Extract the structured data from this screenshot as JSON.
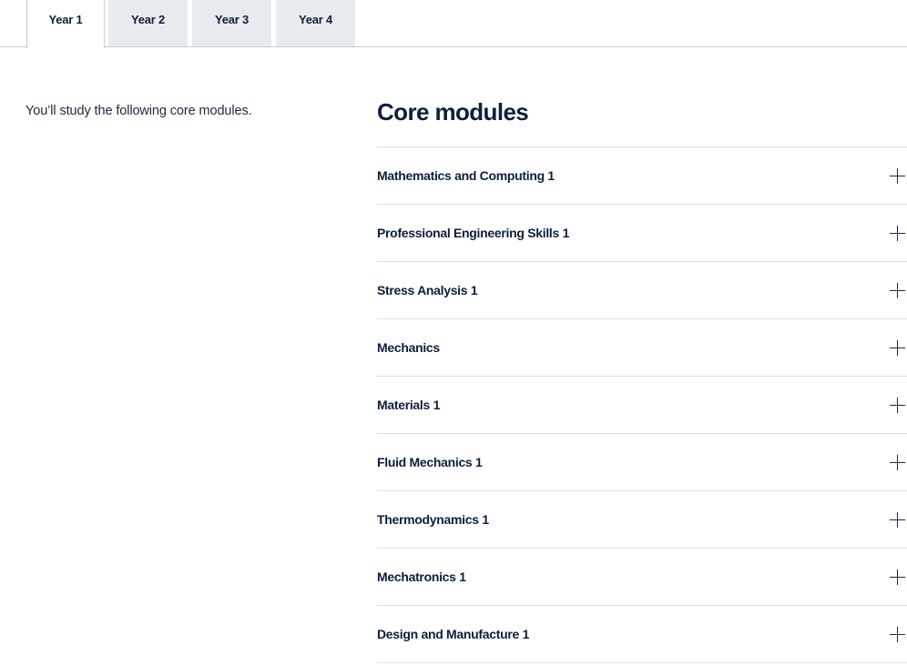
{
  "tabs": [
    {
      "label": "Year 1",
      "active": true
    },
    {
      "label": "Year 2",
      "active": false
    },
    {
      "label": "Year 3",
      "active": false
    },
    {
      "label": "Year 4",
      "active": false
    }
  ],
  "intro": {
    "text": "You’ll study the following core modules."
  },
  "modules": {
    "title": "Core modules",
    "expand_icon": "plus-icon",
    "items": [
      {
        "label": "Mathematics and Computing 1"
      },
      {
        "label": "Professional Engineering Skills 1"
      },
      {
        "label": "Stress Analysis 1"
      },
      {
        "label": "Mechanics"
      },
      {
        "label": "Materials 1"
      },
      {
        "label": "Fluid Mechanics 1"
      },
      {
        "label": "Thermodynamics 1"
      },
      {
        "label": "Mechatronics 1"
      },
      {
        "label": "Design and Manufacture 1"
      }
    ]
  },
  "colors": {
    "text": "#0d1f3c",
    "inactive_tab": "#e8ebee",
    "divider": "#dcdfe2"
  }
}
